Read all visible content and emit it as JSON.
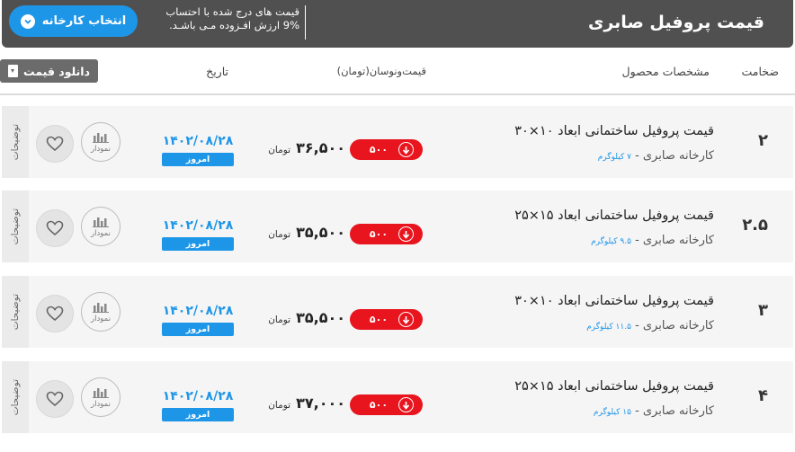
{
  "header": {
    "title": "قیمت پروفیل صابری",
    "note_line1": "قیمت های درج شده با احتساب",
    "note_line2": "9% ارزش افـزوده مـی باشـد.",
    "choose_factory_label": "انتخاب کارخانه"
  },
  "columns": {
    "thickness": "ضخامت",
    "specs": "مشخصات محصول",
    "price_change": "قیمت‌ونوسان(تومان)",
    "date": "تاریخ",
    "download_label": "دانلود قیمت"
  },
  "row_labels": {
    "description_tab": "توضیحات",
    "chart_label": "نمودار",
    "today_label": "امروز",
    "currency": "تومان"
  },
  "rows": [
    {
      "thickness": "۲",
      "name": "قیمت پروفیل ساختمانی ابعاد ۱۰×۳۰",
      "factory": "کارخانه صابری -",
      "weight": "۷ کیلوگرم",
      "price": "۳۶,۵۰۰",
      "change": "۵۰۰",
      "date": "۱۴۰۲/۰۸/۲۸"
    },
    {
      "thickness": "۲.۵",
      "name": "قیمت پروفیل ساختمانی ابعاد ۱۵×۲۵",
      "factory": "کارخانه صابری -",
      "weight": "۹.۵ کیلوگرم",
      "price": "۳۵,۵۰۰",
      "change": "۵۰۰",
      "date": "۱۴۰۲/۰۸/۲۸"
    },
    {
      "thickness": "۳",
      "name": "قیمت پروفیل ساختمانی ابعاد ۱۰×۳۰",
      "factory": "کارخانه صابری -",
      "weight": "۱۱.۵ کیلوگرم",
      "price": "۳۵,۵۰۰",
      "change": "۵۰۰",
      "date": "۱۴۰۲/۰۸/۲۸"
    },
    {
      "thickness": "۴",
      "name": "قیمت پروفیل ساختمانی ابعاد ۱۵×۲۵",
      "factory": "کارخانه صابری -",
      "weight": "۱۵ کیلوگرم",
      "price": "۳۷,۰۰۰",
      "change": "۵۰۰",
      "date": "۱۴۰۲/۰۸/۲۸"
    }
  ],
  "colors": {
    "header_bg": "#505050",
    "accent_blue": "#1e96e8",
    "down_red": "#e8141e"
  }
}
